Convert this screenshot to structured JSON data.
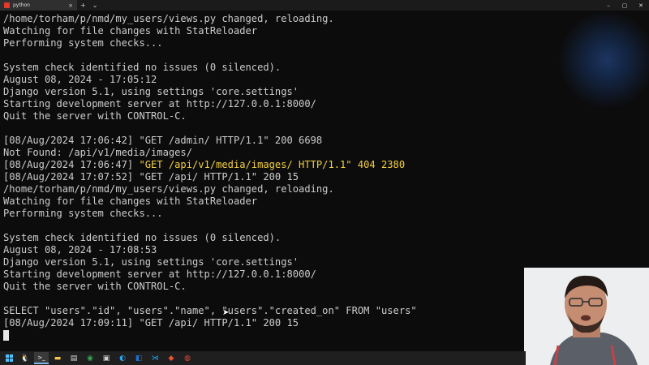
{
  "tab": {
    "title": "python",
    "close": "×"
  },
  "titlebar": {
    "new_tab": "+",
    "dropdown": "⌄",
    "minimize": "–",
    "maximize": "▢",
    "close": "✕"
  },
  "colors": {
    "terminal_bg": "#0c0c0c",
    "text": "#cccccc",
    "warning": "#f4d03f",
    "titlebar": "#1b1b1b",
    "taskbar": "#1f1f1f"
  },
  "terminal": {
    "lines": [
      [
        {
          "t": "/home/torham/p/nmd/my_users/views.py changed, reloading."
        }
      ],
      [
        {
          "t": "Watching for file changes with StatReloader"
        }
      ],
      [
        {
          "t": "Performing system checks..."
        }
      ],
      [
        {
          "t": ""
        }
      ],
      [
        {
          "t": "System check identified no issues (0 silenced)."
        }
      ],
      [
        {
          "t": "August 08, 2024 - 17:05:12"
        }
      ],
      [
        {
          "t": "Django version 5.1, using settings 'core.settings'"
        }
      ],
      [
        {
          "t": "Starting development server at http://127.0.0.1:8000/"
        }
      ],
      [
        {
          "t": "Quit the server with CONTROL-C."
        }
      ],
      [
        {
          "t": ""
        }
      ],
      [
        {
          "t": "[08/Aug/2024 17:06:42] \"GET /admin/ HTTP/1.1\" 200 6698"
        }
      ],
      [
        {
          "t": "Not Found: /api/v1/media/images/"
        }
      ],
      [
        {
          "t": "[08/Aug/2024 17:06:47] "
        },
        {
          "t": "\"GET /api/v1/media/images/ HTTP/1.1\" 404 2380",
          "c": "yellow"
        }
      ],
      [
        {
          "t": "[08/Aug/2024 17:07:52] \"GET /api/ HTTP/1.1\" 200 15"
        }
      ],
      [
        {
          "t": "/home/torham/p/nmd/my_users/views.py changed, reloading."
        }
      ],
      [
        {
          "t": "Watching for file changes with StatReloader"
        }
      ],
      [
        {
          "t": "Performing system checks..."
        }
      ],
      [
        {
          "t": ""
        }
      ],
      [
        {
          "t": "System check identified no issues (0 silenced)."
        }
      ],
      [
        {
          "t": "August 08, 2024 - 17:08:53"
        }
      ],
      [
        {
          "t": "Django version 5.1, using settings 'core.settings'"
        }
      ],
      [
        {
          "t": "Starting development server at http://127.0.0.1:8000/"
        }
      ],
      [
        {
          "t": "Quit the server with CONTROL-C."
        }
      ],
      [
        {
          "t": ""
        }
      ],
      [
        {
          "t": "SELECT \"users\".\"id\", \"users\".\"name\", \"users\".\"created_on\" FROM \"users\""
        }
      ],
      [
        {
          "t": "[08/Aug/2024 17:09:11] \"GET /api/ HTTP/1.1\" 200 15"
        }
      ]
    ]
  },
  "taskbar": {
    "items": [
      {
        "name": "start-button",
        "icon": "windows-icon",
        "active": false
      },
      {
        "name": "taskbar-app-linux",
        "icon": "penguin-icon",
        "glyph": "🐧",
        "active": false
      },
      {
        "name": "taskbar-app-terminal",
        "icon": "terminal-icon",
        "glyph": ">_",
        "active": true
      },
      {
        "name": "taskbar-app-explorer",
        "icon": "folder-icon",
        "glyph": "▬",
        "color": "#f2c94c",
        "active": false
      },
      {
        "name": "taskbar-app-notes",
        "icon": "notes-icon",
        "glyph": "▤",
        "color": "#d9d9d9",
        "active": false
      },
      {
        "name": "taskbar-app-chrome",
        "icon": "chrome-icon",
        "glyph": "◉",
        "color": "#34a853",
        "active": false
      },
      {
        "name": "taskbar-app-screenshot",
        "icon": "camera-icon",
        "glyph": "▣",
        "color": "#cfcfcf",
        "active": false
      },
      {
        "name": "taskbar-app-edge",
        "icon": "edge-icon",
        "glyph": "◐",
        "color": "#2ea3f2",
        "active": false
      },
      {
        "name": "taskbar-app-outlook",
        "icon": "mail-icon",
        "glyph": "◧",
        "color": "#1b73d1",
        "active": false
      },
      {
        "name": "taskbar-app-vscode",
        "icon": "vscode-icon",
        "glyph": "⋊",
        "color": "#23a9f2",
        "active": false
      },
      {
        "name": "taskbar-app-git",
        "icon": "git-icon",
        "glyph": "◆",
        "color": "#f05133",
        "active": false
      },
      {
        "name": "taskbar-app-record",
        "icon": "record-icon",
        "glyph": "◍",
        "color": "#e0473b",
        "active": false
      }
    ]
  }
}
